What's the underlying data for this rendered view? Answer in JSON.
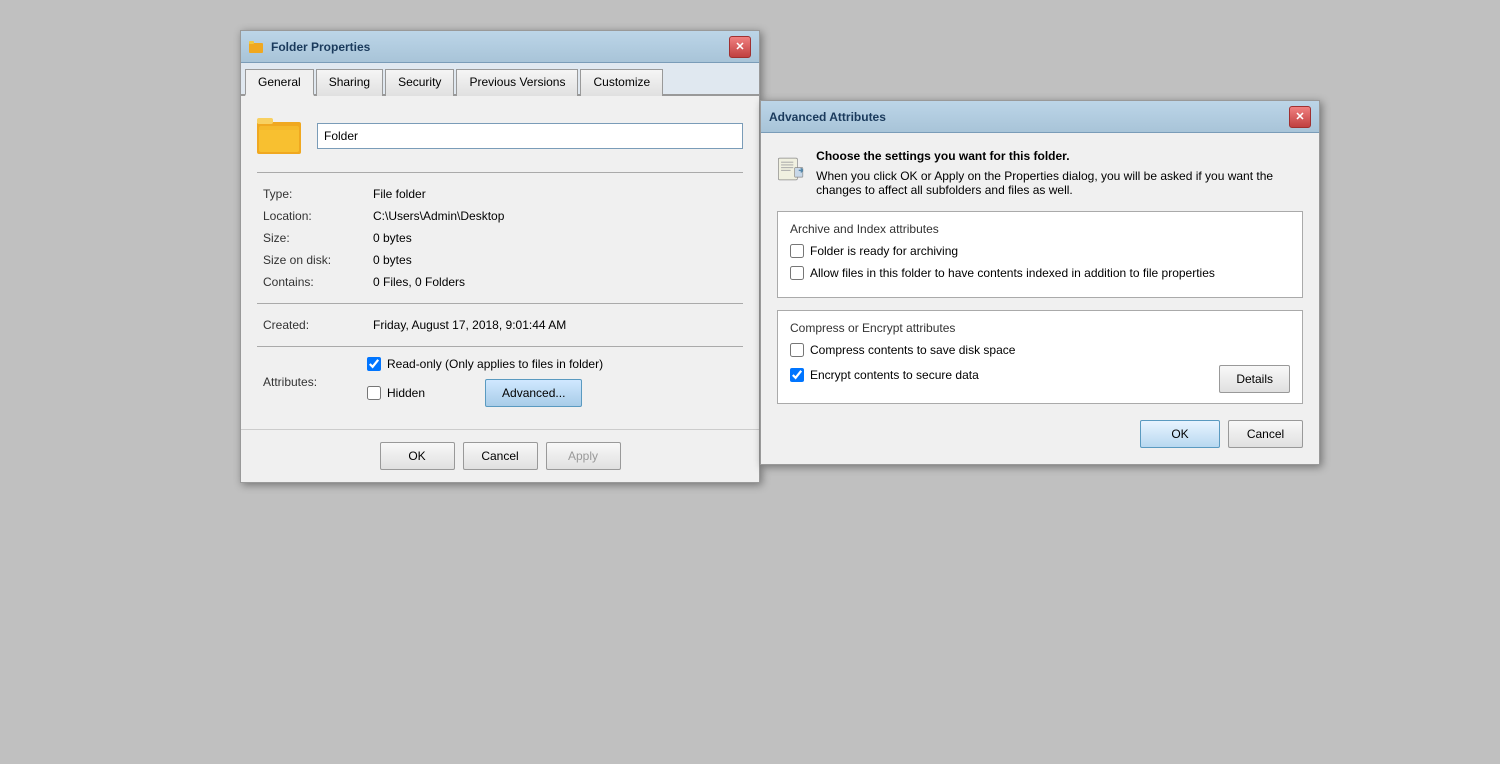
{
  "folderProps": {
    "title": "Folder Properties",
    "tabs": [
      {
        "id": "general",
        "label": "General",
        "active": true
      },
      {
        "id": "sharing",
        "label": "Sharing",
        "active": false
      },
      {
        "id": "security",
        "label": "Security",
        "active": false
      },
      {
        "id": "previous-versions",
        "label": "Previous Versions",
        "active": false
      },
      {
        "id": "customize",
        "label": "Customize",
        "active": false
      }
    ],
    "folderName": "Folder",
    "type_label": "Type:",
    "type_value": "File folder",
    "location_label": "Location:",
    "location_value": "C:\\Users\\Admin\\Desktop",
    "size_label": "Size:",
    "size_value": "0 bytes",
    "size_on_disk_label": "Size on disk:",
    "size_on_disk_value": "0 bytes",
    "contains_label": "Contains:",
    "contains_value": "0 Files, 0 Folders",
    "created_label": "Created:",
    "created_value": "Friday, August 17, 2018, 9:01:44 AM",
    "attributes_label": "Attributes:",
    "readonly_label": "Read-only (Only applies to files in folder)",
    "readonly_checked": true,
    "hidden_label": "Hidden",
    "hidden_checked": false,
    "advanced_btn": "Advanced...",
    "ok_btn": "OK",
    "cancel_btn": "Cancel",
    "apply_btn": "Apply"
  },
  "advancedAttrs": {
    "title": "Advanced Attributes",
    "description_line1": "Choose the settings you want for this folder.",
    "description_line2": "When you click OK or Apply on the Properties dialog, you will be asked if you want the changes to affect all subfolders and files as well.",
    "archive_section_title": "Archive and Index attributes",
    "archive_label": "Folder is ready for archiving",
    "archive_checked": false,
    "index_label": "Allow files in this folder to have contents indexed in addition to file properties",
    "index_checked": false,
    "compress_section_title": "Compress or Encrypt attributes",
    "compress_label": "Compress contents to save disk space",
    "compress_checked": false,
    "encrypt_label": "Encrypt contents to secure data",
    "encrypt_checked": true,
    "details_btn": "Details",
    "ok_btn": "OK",
    "cancel_btn": "Cancel"
  }
}
